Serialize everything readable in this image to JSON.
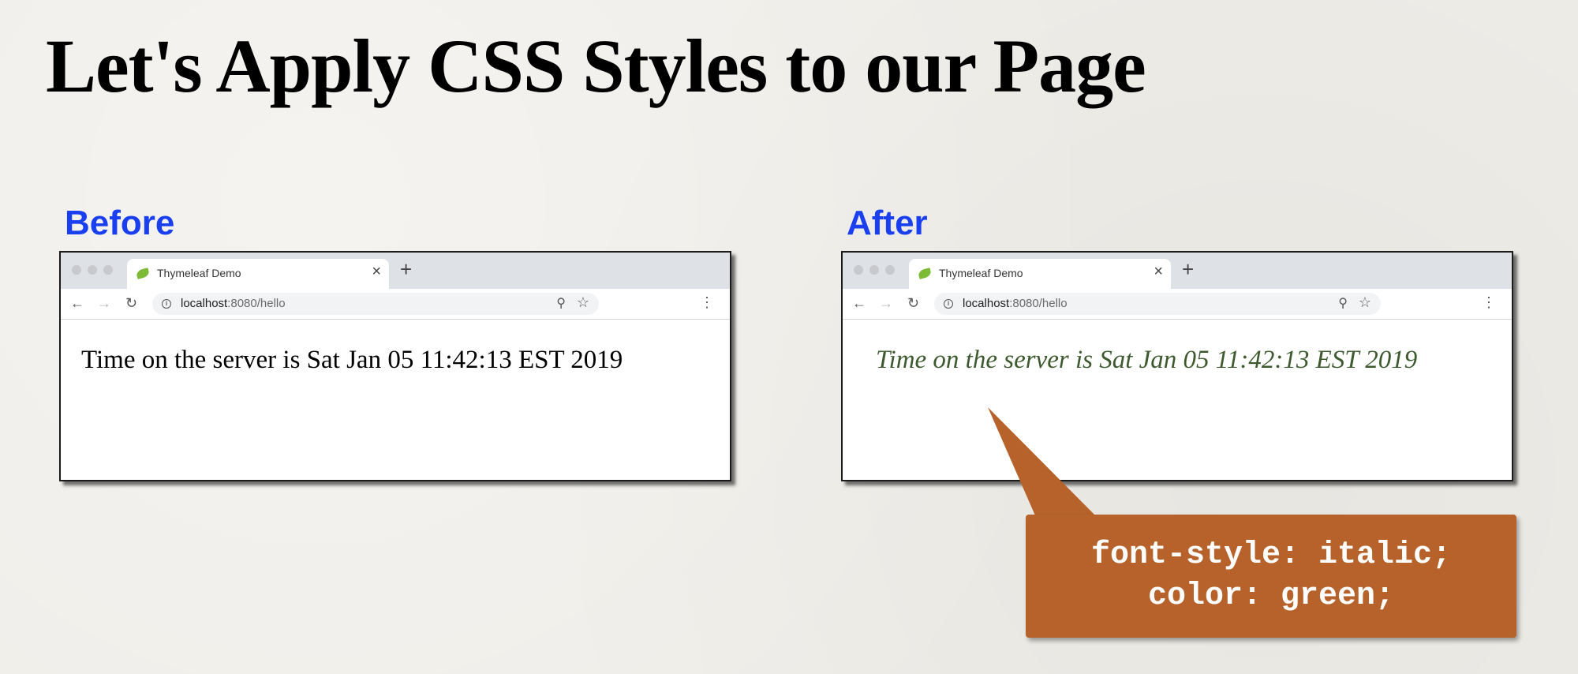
{
  "slide": {
    "title": "Let's Apply CSS Styles to our Page"
  },
  "before": {
    "label": "Before",
    "browser": {
      "tab_title": "Thymeleaf Demo",
      "url_host": "localhost",
      "url_rest": ":8080/hello",
      "content": "Time on the server is Sat Jan 05 11:42:13 EST 2019"
    }
  },
  "after": {
    "label": "After",
    "browser": {
      "tab_title": "Thymeleaf Demo",
      "url_host": "localhost",
      "url_rest": ":8080/hello",
      "content": "Time on the server is Sat Jan 05 11:42:13 EST 2019"
    }
  },
  "callout": {
    "lines": [
      "font-style: italic;",
      "color: green;"
    ]
  },
  "colors": {
    "label_blue": "#1a3ff0",
    "styled_text_green": "#3d5a2e",
    "callout_orange": "#b6622a"
  },
  "icons": {
    "back": "arrow-left-icon",
    "forward": "arrow-right-icon",
    "reload": "reload-icon",
    "info": "info-icon",
    "zoom": "zoom-icon",
    "bookmark": "star-icon",
    "menu": "kebab-menu-icon",
    "close": "close-icon",
    "new_tab": "plus-icon",
    "favicon": "leaf-icon"
  }
}
